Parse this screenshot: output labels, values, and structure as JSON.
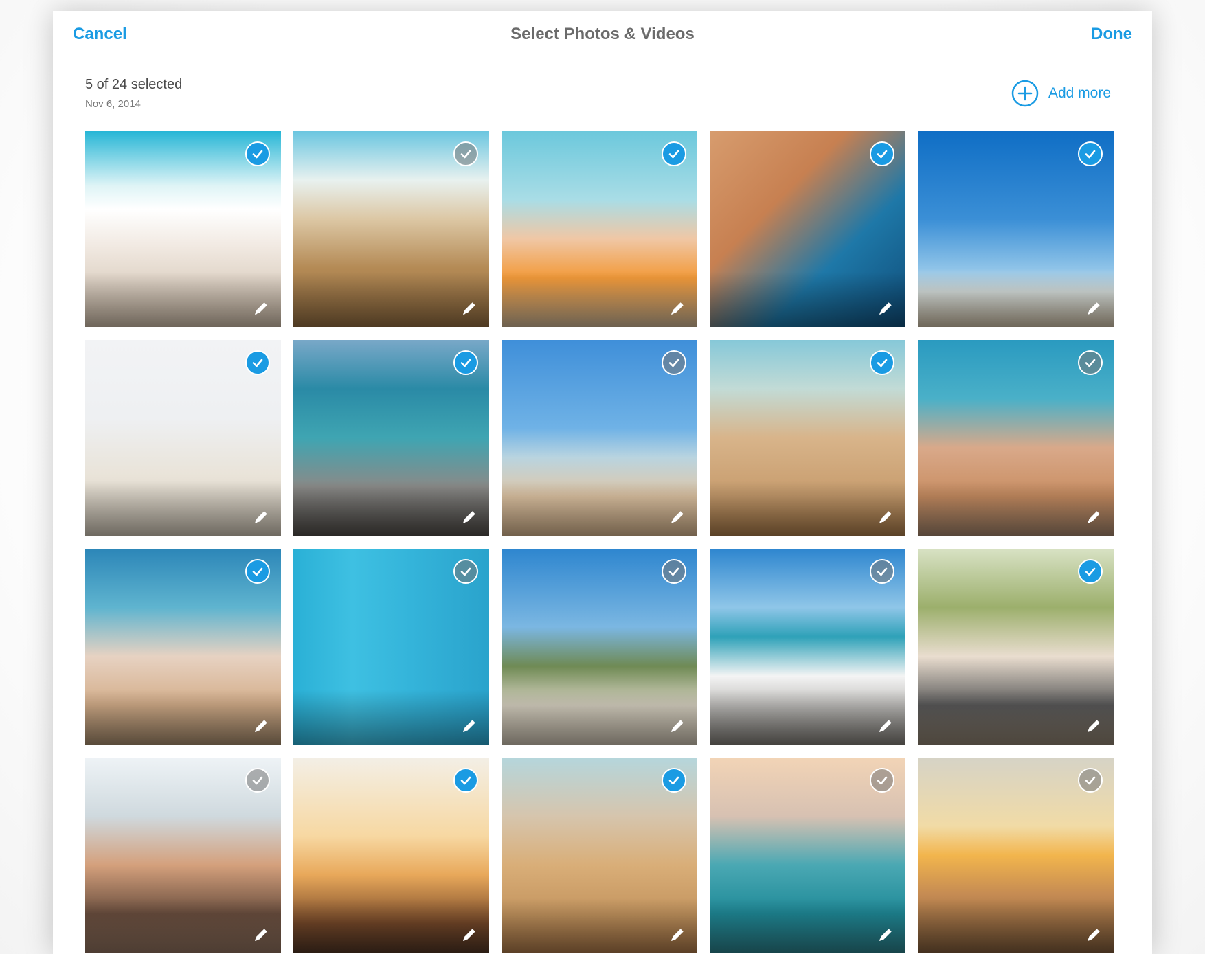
{
  "navbar": {
    "cancel_label": "Cancel",
    "title": "Select Photos & Videos",
    "done_label": "Done"
  },
  "header": {
    "selection_count": "5 of 24 selected",
    "date": "Nov 6, 2014",
    "add_more_label": "Add more",
    "add_more_icon": "plus-circle-icon"
  },
  "colors": {
    "accent": "#1a9be3",
    "title_gray": "#6b6b6b"
  },
  "photos": [
    {
      "name": "girl-building-sandcastle",
      "selected": true,
      "bg": "linear-gradient(180deg,#27b6d6 0%,#dff4f6 28%,#ffffff 40%,#f0e8e0 60%,#c9b8a4 100%)"
    },
    {
      "name": "sandcastle-closeup",
      "selected": false,
      "bg": "linear-gradient(180deg,#6bc6e0 0%,#e8f1ef 25%,#dcc7a4 45%,#b48a55 70%,#8e6a3f 100%)"
    },
    {
      "name": "kids-in-snorkel-masks",
      "selected": true,
      "bg": "linear-gradient(180deg,#6cc8dc 0%,#a9dde6 35%,#f0c7a5 55%,#f29a3a 75%,#c7b08f 100%)"
    },
    {
      "name": "kids-underwater-goggles",
      "selected": true,
      "bg": "linear-gradient(135deg,#d79c6e 0%,#c78051 35%,#1e78a8 65%,#0f4c78 100%)"
    },
    {
      "name": "father-tossing-child",
      "selected": true,
      "bg": "linear-gradient(180deg,#0f6ec5 0%,#3b8fd6 45%,#8ec3e8 70%,#dfe7e4 82%,#c9bba3 100%)"
    },
    {
      "name": "family-running-beach",
      "selected": true,
      "bg": "linear-gradient(180deg,#f2f3f5 0%,#eef0f2 40%,#e9e3d8 70%,#c8bfb0 100%)"
    },
    {
      "name": "child-on-rock-sea",
      "selected": true,
      "bg": "linear-gradient(180deg,#79a8c8 0%,#2a8aa6 25%,#3fa5b2 50%,#8a8a88 75%,#4e4a46 100%)"
    },
    {
      "name": "boy-playing-sand",
      "selected": false,
      "bg": "linear-gradient(180deg,#3f8fd9 0%,#6fb2e6 45%,#b9d4e0 60%,#e2c7a6 80%,#d0b08a 100%)"
    },
    {
      "name": "shovel-bucket-sand",
      "selected": true,
      "bg": "linear-gradient(180deg,#86c8d8 0%,#c2dbd6 25%,#d8b48a 50%,#c79c6d 80%,#a57848 100%)"
    },
    {
      "name": "mother-daughter-shore",
      "selected": false,
      "bg": "linear-gradient(180deg,#2a9ac0 0%,#4ab0c8 30%,#d9a98a 55%,#c98e62 80%,#9e8068 100%)"
    },
    {
      "name": "mother-daughter-laughing",
      "selected": true,
      "bg": "linear-gradient(180deg,#2c86b8 0%,#5fb4cf 30%,#e7d2c2 55%,#d4ae8a 80%,#a3896b 100%)"
    },
    {
      "name": "blue-wood-fish",
      "selected": false,
      "bg": "linear-gradient(90deg,#2ab0d6 0%,#3ec0e2 30%,#34b4da 60%,#2aa3cc 100%)"
    },
    {
      "name": "beach-houses-dunes",
      "selected": false,
      "bg": "linear-gradient(180deg,#2e86cf 0%,#7bb7e2 40%,#6f8a54 60%,#d9d3c3 80%,#c8bfae 100%)"
    },
    {
      "name": "deck-tables-ocean",
      "selected": false,
      "bg": "linear-gradient(180deg,#2e86cf 0%,#8fc6e8 30%,#2ea1b8 45%,#f4f4f4 65%,#7d7a74 100%)"
    },
    {
      "name": "family-barbecue-deck",
      "selected": true,
      "bg": "linear-gradient(180deg,#d8e2c4 0%,#9caf6c 30%,#e9ddcf 55%,#5a5a5a 80%,#8c7f6e 100%)"
    },
    {
      "name": "mother-son-hugging",
      "selected": false,
      "bg": "linear-gradient(180deg,#eef3f6 0%,#cfd9de 30%,#d4a07c 55%,#6b4f3f 80%,#8c6f5c 100%)"
    },
    {
      "name": "couple-sunset-splash",
      "selected": true,
      "bg": "linear-gradient(180deg,#f3efe6 0%,#f7d8a2 40%,#e8a85a 60%,#7a4b2b 85%,#4e3424 100%)"
    },
    {
      "name": "shovel-bucket-closeup",
      "selected": true,
      "bg": "linear-gradient(180deg,#b5d6dc 0%,#d6c5ad 30%,#d9ae78 55%,#c4955f 80%,#a57446 100%)"
    },
    {
      "name": "swimmer-in-waves",
      "selected": false,
      "bg": "linear-gradient(180deg,#f2d4b6 0%,#d7c1b2 30%,#4aa8b3 55%,#1f8a98 80%,#2a7c86 100%)"
    },
    {
      "name": "sunset-beach-grass",
      "selected": false,
      "bg": "linear-gradient(180deg,#d6d3c6 0%,#f1dba6 35%,#f2b54d 50%,#c58b53 70%,#7a5838 100%)"
    }
  ]
}
